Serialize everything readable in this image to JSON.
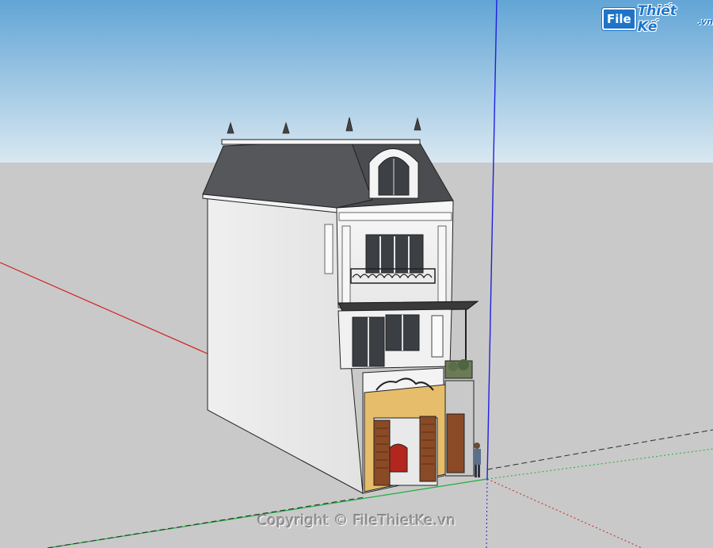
{
  "viewport": {
    "sky_color_top": "#62a5d6",
    "sky_color_bottom": "#d9e8f1",
    "ground_color": "#c9c9c9",
    "axis_red": "#d21f1f",
    "axis_green": "#1fae3c",
    "axis_blue": "#1f1fe0"
  },
  "watermark": {
    "logo_file": "File",
    "logo_rest": "Thiết Kế",
    "logo_domain": ".vn",
    "brand_color": "#1f74c8",
    "copyright": "Copyright © FileThietKe.vn"
  },
  "model": {
    "wall_color": "#f1f1f1",
    "roof_color": "#55575a",
    "gate_color": "#e6bd6a",
    "door_color": "#8a4a25",
    "glass_color": "#404448"
  }
}
